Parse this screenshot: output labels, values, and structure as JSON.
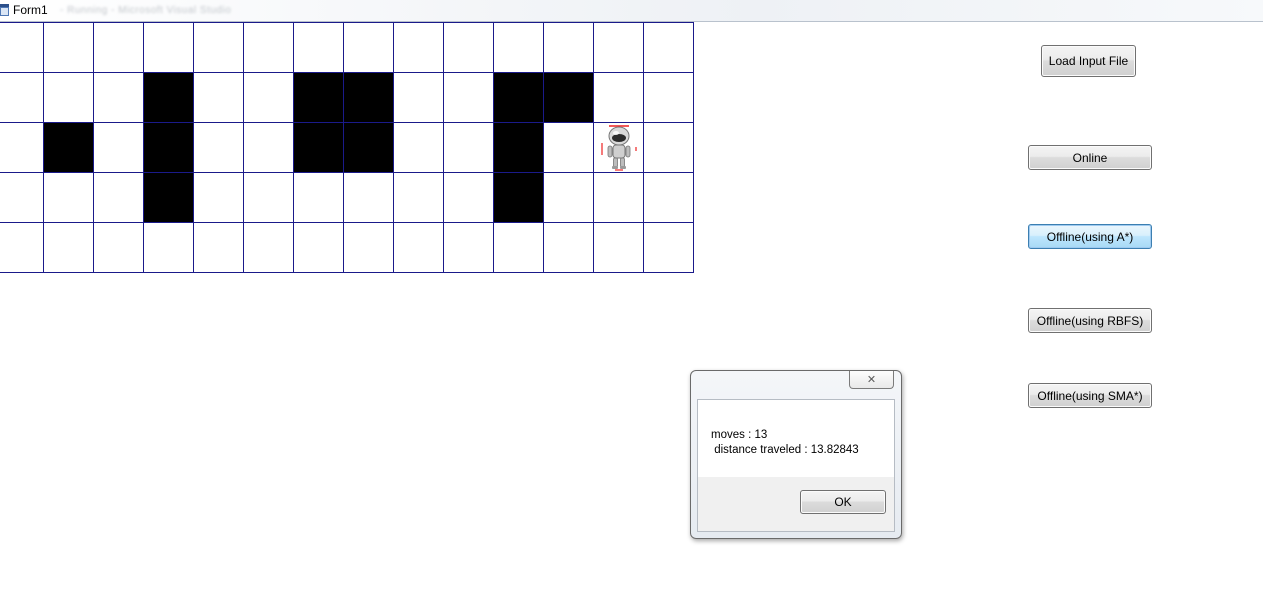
{
  "window": {
    "title": "Form1",
    "blurred_title": "- Running - Microsoft Visual Studio"
  },
  "grid": {
    "cols": 14,
    "rows": 5,
    "blocked": [
      [
        1,
        3
      ],
      [
        1,
        6
      ],
      [
        1,
        7
      ],
      [
        1,
        10
      ],
      [
        1,
        11
      ],
      [
        2,
        1
      ],
      [
        2,
        3
      ],
      [
        2,
        6
      ],
      [
        2,
        7
      ],
      [
        2,
        10
      ],
      [
        3,
        3
      ],
      [
        3,
        10
      ]
    ],
    "robot": [
      2,
      12
    ],
    "colors": {
      "line": "#1a1a8a",
      "blocked": "#000000",
      "free": "#ffffff"
    }
  },
  "buttons": {
    "load": "Load Input File",
    "online": "Online",
    "astar": "Offline(using A*)",
    "rbfs": "Offline(using RBFS)",
    "sma": "Offline(using SMA*)"
  },
  "dialog": {
    "close_glyph": "✕",
    "line1": "moves : 13",
    "line2": " distance traveled : 13.82843",
    "ok": "OK"
  }
}
